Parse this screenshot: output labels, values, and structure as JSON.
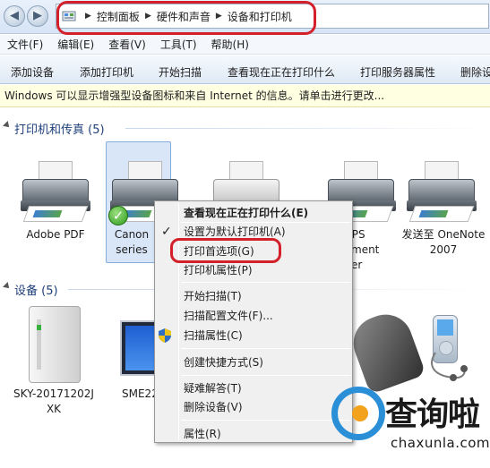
{
  "breadcrumb": {
    "items": [
      "控制面板",
      "硬件和声音",
      "设备和打印机"
    ]
  },
  "menubar": {
    "items": [
      "文件(F)",
      "编辑(E)",
      "查看(V)",
      "工具(T)",
      "帮助(H)"
    ]
  },
  "toolbar": {
    "items": [
      "添加设备",
      "添加打印机",
      "开始扫描",
      "查看现在正在打印什么",
      "打印服务器属性",
      "删除设"
    ]
  },
  "infobar": {
    "text": "Windows 可以显示增强型设备图标和来自 Internet 的信息。请单击进行更改..."
  },
  "sections": {
    "printers": "打印机和传真 (5)",
    "devices": "设备 (5)"
  },
  "printers": [
    {
      "line1": "Adobe PDF",
      "line2": ""
    },
    {
      "line1": "Canon",
      "line2": "series"
    },
    {
      "line1": "",
      "line2": ""
    },
    {
      "line1": "ft XPS",
      "line2": "ment",
      "line3": "er"
    },
    {
      "line1": "发送至 OneNote",
      "line2": "2007"
    }
  ],
  "devices": [
    {
      "line1": "SKY-20171202J",
      "line2": "XK"
    },
    {
      "line1": "SME22",
      "line2": ""
    }
  ],
  "context_menu": {
    "items": [
      "查看现在正在打印什么(E)",
      "设置为默认打印机(A)",
      "打印首选项(G)",
      "打印机属性(P)",
      "开始扫描(T)",
      "扫描配置文件(F)...",
      "扫描属性(C)",
      "创建快捷方式(S)",
      "疑难解答(T)",
      "删除设备(V)",
      "属性(R)"
    ],
    "checkmark": "✓"
  },
  "watermark": {
    "text": "查询啦",
    "url": "chaxunla.com"
  },
  "colors": {
    "highlight_ring": "#d4202a",
    "selection": "#d8e6f7",
    "info_bar": "#ffffe1"
  }
}
